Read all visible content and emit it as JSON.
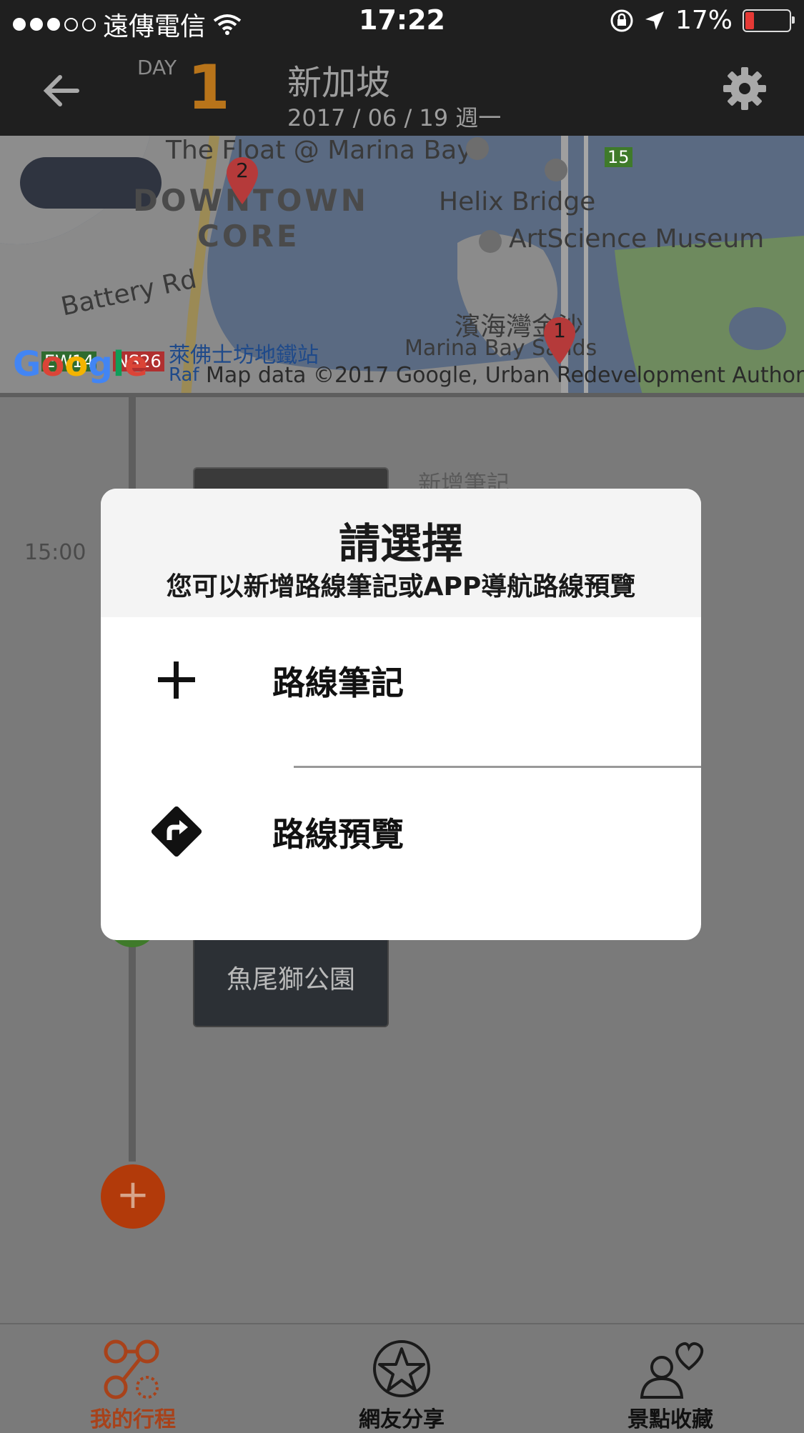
{
  "status_bar": {
    "carrier": "遠傳電信",
    "time": "17:22",
    "battery": "17%"
  },
  "header": {
    "day_label": "DAY",
    "day_number": "1",
    "city": "新加坡",
    "date": "2017 / 06 / 19 週一"
  },
  "map": {
    "labels": [
      "The Float @ Marina Bay",
      "DOWNTOWN",
      "CORE",
      "Helix Bridge",
      "ArtScience Museum",
      "Battery Rd",
      "濱海灣金沙",
      "Marina Bay Sands",
      "萊佛士坊地鐵站",
      "EW14",
      "NS26",
      "Raf",
      "15"
    ],
    "markers": [
      "2",
      "1"
    ],
    "google": "Google",
    "attribution": "Map data ©2017 Google, Urban Redevelopment Authority"
  },
  "timeline": {
    "time": "15:00",
    "new_note": "新增筆記",
    "spot_name": "魚尾獅公園",
    "add_symbol": "+"
  },
  "dialog": {
    "title": "請選擇",
    "subtitle": "您可以新增路線筆記或APP導航路線預覽",
    "options": [
      {
        "label": "路線筆記",
        "icon": "plus-icon"
      },
      {
        "label": "路線預覽",
        "icon": "directions-icon"
      }
    ]
  },
  "bottom_nav": {
    "items": [
      {
        "label": "我的行程",
        "icon": "route-icon",
        "active": true
      },
      {
        "label": "網友分享",
        "icon": "star-icon",
        "active": false
      },
      {
        "label": "景點收藏",
        "icon": "favorites-icon",
        "active": false
      }
    ]
  },
  "colors": {
    "accent": "#b8741a",
    "active_nav": "#a8421a",
    "overlay": "#7a7a7a"
  }
}
